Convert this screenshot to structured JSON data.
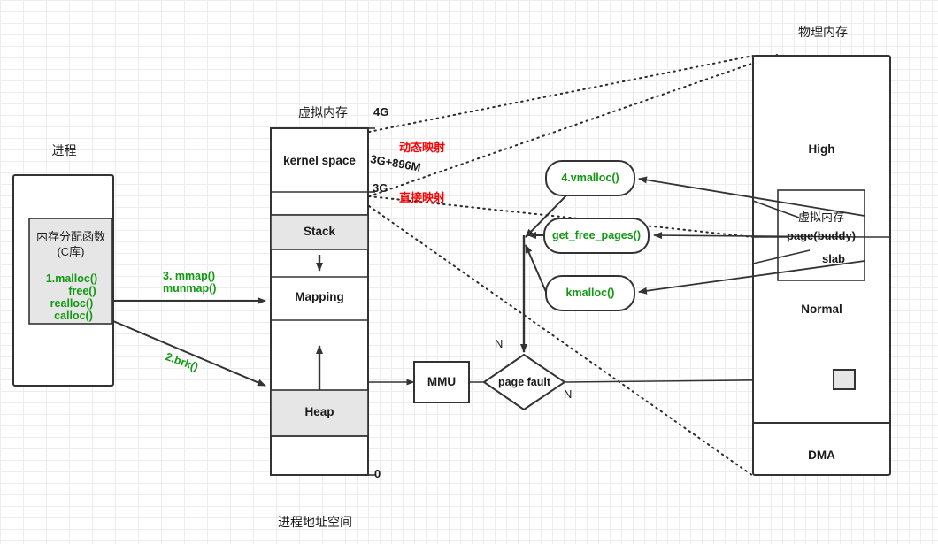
{
  "diagram": {
    "titles": {
      "process": "进程",
      "virtual_memory": "虚拟内存",
      "physical_memory": "物理内存",
      "process_address_space": "进程地址空间"
    },
    "process_box": {
      "inner_title_line1": "内存分配函数",
      "inner_title_line2": "(C库)",
      "functions": [
        "1.malloc()",
        "free()",
        "realloc()",
        "calloc()"
      ]
    },
    "arrow_labels": {
      "mmap_line1": "3. mmap()",
      "mmap_line2": "munmap()",
      "brk": "2.brk()"
    },
    "virtual_memory": {
      "segments": [
        "kernel space",
        "",
        "Stack",
        "",
        "Mapping",
        "",
        "Heap",
        ""
      ],
      "addresses": {
        "top": "4G",
        "kernel_split": "3G+896M",
        "user_top": "3G",
        "bottom": "0"
      },
      "mapping_notes": {
        "dynamic": "动态映射",
        "direct": "直接映射"
      }
    },
    "kernel_allocators": [
      "4.vmalloc()",
      "get_free_pages()",
      "kmalloc()"
    ],
    "mmu": {
      "label": "MMU",
      "page_fault": "page  fault",
      "branch_top": "N",
      "branch_right": "N"
    },
    "physical_memory": {
      "zones": [
        "High",
        "Normal",
        "DMA"
      ],
      "inner_box": {
        "virtual_memory": "虚拟内存",
        "page_buddy": "page(buddy)",
        "slab": "slab"
      }
    },
    "colors": {
      "green": "#119911",
      "red": "#ff0000",
      "stroke": "#333333",
      "fill_gray": "#e6e6e6",
      "grid_minor": "#ededed",
      "grid_major": "#dadada"
    }
  }
}
